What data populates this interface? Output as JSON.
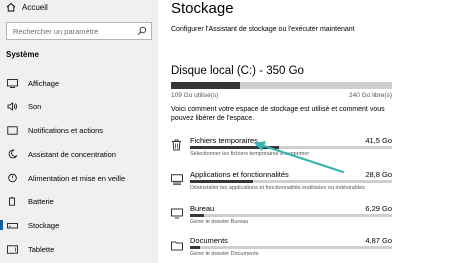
{
  "sidebar": {
    "home_label": "Accueil",
    "search": {
      "placeholder": "Rechercher un paramètre"
    },
    "section_title": "Système",
    "items": [
      {
        "label": "Affichage",
        "icon": "display-icon"
      },
      {
        "label": "Son",
        "icon": "speaker-icon"
      },
      {
        "label": "Notifications et actions",
        "icon": "notifications-icon"
      },
      {
        "label": "Assistant de concentration",
        "icon": "moon-icon"
      },
      {
        "label": "Alimentation et mise en veille",
        "icon": "power-icon"
      },
      {
        "label": "Batterie",
        "icon": "battery-icon"
      },
      {
        "label": "Stockage",
        "icon": "storage-icon",
        "selected": true
      },
      {
        "label": "Tablette",
        "icon": "tablet-icon"
      }
    ]
  },
  "main": {
    "title": "Stockage",
    "subtitle": "Configurer l'Assistant de stockage ou l'exécuter maintenant",
    "disk": {
      "title": "Disque local (C:) - 350 Go",
      "used_label": "109 Go utilisé(s)",
      "free_label": "240 Go libre(s)",
      "used_fraction": 0.31
    },
    "description": "Voici comment votre espace de stockage est utilisé et comment vous pouvez libérer de l'espace.",
    "categories": [
      {
        "name": "Fichiers temporaires",
        "size": "41,5 Go",
        "fill": 0.44,
        "sub": "Sélectionner les fichiers temporaires à supprimer",
        "icon": "trash-icon"
      },
      {
        "name": "Applications et fonctionnalités",
        "size": "28,8 Go",
        "fill": 0.31,
        "sub": "Désinstaller les applications et fonctionnalités inutilisées ou indésirables",
        "icon": "apps-icon"
      },
      {
        "name": "Bureau",
        "size": "6,29 Go",
        "fill": 0.07,
        "sub": "Gérer le dossier Bureau",
        "icon": "desktop-icon"
      },
      {
        "name": "Documents",
        "size": "4,87 Go",
        "fill": 0.05,
        "sub": "Gérer le dossier Documents",
        "icon": "folder-icon"
      }
    ]
  },
  "colors": {
    "accent": "#0063b1",
    "arrow": "#36b5b0",
    "bar_fill": "#363636",
    "bar_track": "#cfcfcf"
  }
}
